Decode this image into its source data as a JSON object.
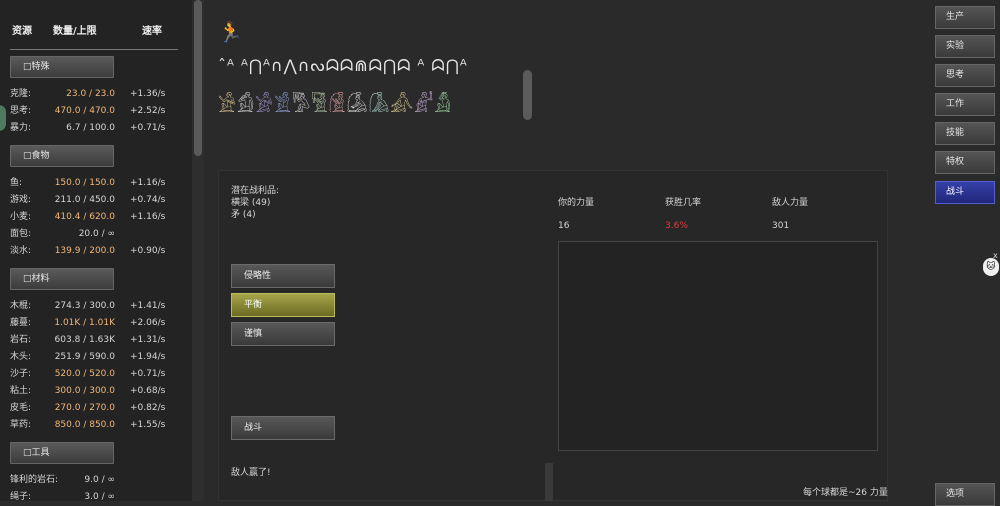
{
  "resources_panel": {
    "headers": {
      "resource": "资源",
      "amount": "数量/上限",
      "rate": "速率"
    },
    "categories": [
      {
        "label": "□特殊",
        "items": [
          {
            "name": "克隆:",
            "value": "23.0 / 23.0",
            "full": true,
            "rate": "+1.36/s"
          },
          {
            "name": "思考:",
            "value": "470.0 / 470.0",
            "full": true,
            "rate": "+2.52/s"
          },
          {
            "name": "暴力:",
            "value": "6.7 / 100.0",
            "full": false,
            "rate": "+0.71/s"
          }
        ]
      },
      {
        "label": "□食物",
        "items": [
          {
            "name": "鱼:",
            "value": "150.0 / 150.0",
            "full": true,
            "rate": "+1.16/s"
          },
          {
            "name": "游戏:",
            "value": "211.0 / 450.0",
            "full": false,
            "rate": "+0.74/s"
          },
          {
            "name": "小麦:",
            "value": "410.4 / 620.0",
            "full": true,
            "rate": "+1.16/s"
          },
          {
            "name": "面包:",
            "value": "20.0 / ∞",
            "full": false,
            "rate": ""
          },
          {
            "name": "淡水:",
            "value": "139.9 / 200.0",
            "full": true,
            "rate": "+0.90/s"
          }
        ]
      },
      {
        "label": "□材料",
        "items": [
          {
            "name": "木棍:",
            "value": "274.3 / 300.0",
            "full": false,
            "rate": "+1.41/s"
          },
          {
            "name": "藤蔓:",
            "value": "1.01K / 1.01K",
            "full": true,
            "rate": "+2.06/s"
          },
          {
            "name": "岩石:",
            "value": "603.8 / 1.63K",
            "full": false,
            "rate": "+1.31/s"
          },
          {
            "name": "木头:",
            "value": "251.9 / 590.0",
            "full": false,
            "rate": "+1.94/s"
          },
          {
            "name": "沙子:",
            "value": "520.0 / 520.0",
            "full": true,
            "rate": "+0.71/s"
          },
          {
            "name": "粘土:",
            "value": "300.0 / 300.0",
            "full": true,
            "rate": "+0.68/s"
          },
          {
            "name": "皮毛:",
            "value": "270.0 / 270.0",
            "full": true,
            "rate": "+0.82/s"
          },
          {
            "name": "草药:",
            "value": "850.0 / 850.0",
            "full": true,
            "rate": "+1.55/s"
          }
        ]
      },
      {
        "label": "□工具",
        "items": [
          {
            "name": "锋利的岩石:",
            "value": "9.0 / ∞",
            "full": false,
            "rate": ""
          },
          {
            "name": "绳子:",
            "value": "3.0 / ∞",
            "full": false,
            "rate": ""
          }
        ]
      }
    ]
  },
  "glyphs": {
    "figure": "🏃",
    "line1": "ˆᴬ ᴬ⋂ᴬ∩⋀∩ᔓᗣᗣ⋒ᗣ⋂ᗣ ᴬ ᗣ⋂ᴬ",
    "line2": "𓀀𓀁𓀂𓀃𓀄𓀅𓀆𓀇𓀈𓀉𓀊𓀋"
  },
  "battle": {
    "loot_title": "潜在战利品:",
    "loot_items": [
      "横梁 (49)",
      "矛 (4)"
    ],
    "stances": [
      "侵略性",
      "平衡",
      "谨慎"
    ],
    "active_stance": 1,
    "fight_button": "战斗",
    "result_text": "敌人赢了!",
    "stats_headers": {
      "your_power": "你的力量",
      "win_chance": "获胜几率",
      "enemy_power": "敌人力量"
    },
    "your_power": "16",
    "win_chance": "3.6%",
    "enemy_power": "301",
    "footer_text": "每个球都是~26 力量",
    "win_chance_color": "#e23b3b"
  },
  "nav": {
    "items": [
      "生产",
      "实验",
      "思考",
      "工作",
      "技能",
      "特权",
      "战斗"
    ],
    "active": 6,
    "options": "选项"
  },
  "side": {
    "close": "x",
    "cat_icon": "🐱"
  },
  "colors": {
    "accent_active_nav": "#2a33a0",
    "accent_active_stance": "#9b9a3a",
    "full_value": "#f0b87a"
  }
}
